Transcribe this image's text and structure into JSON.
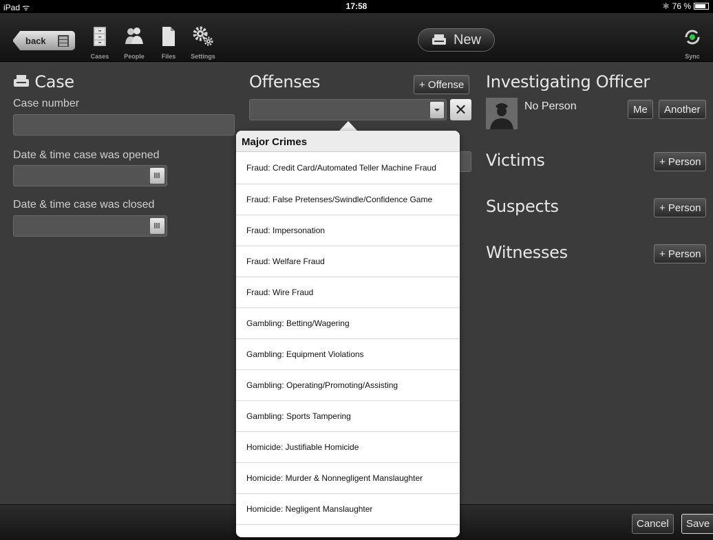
{
  "status_bar": {
    "device": "iPad",
    "time": "17:58",
    "battery": "76 %",
    "battery_level": 0.76
  },
  "toolbar": {
    "back_label": "back",
    "items": [
      {
        "label": "Cases",
        "icon": "cabinet-icon"
      },
      {
        "label": "People",
        "icon": "people-icon"
      },
      {
        "label": "Files",
        "icon": "files-icon"
      },
      {
        "label": "Settings",
        "icon": "gear-icon"
      }
    ],
    "new_label": "New",
    "sync_label": "Sync"
  },
  "case": {
    "title": "Case",
    "case_number_label": "Case number",
    "case_number_value": "",
    "opened_label": "Date & time case was opened",
    "opened_value": "",
    "closed_label": "Date & time case was closed",
    "closed_value": ""
  },
  "offenses": {
    "title": "Offenses",
    "add_label": "+ Offense",
    "selected_value": "",
    "clear_label": "✕"
  },
  "officer": {
    "title": "Investigating Officer",
    "person_name": "No Person",
    "me_label": "Me",
    "another_label": "Another"
  },
  "victims": {
    "title": "Victims",
    "add_label": "+ Person"
  },
  "suspects": {
    "title": "Suspects",
    "add_label": "+ Person"
  },
  "witnesses": {
    "title": "Witnesses",
    "add_label": "+ Person"
  },
  "footer": {
    "cancel_label": "Cancel",
    "save_label": "Save"
  },
  "popover": {
    "section_title": "Major Crimes",
    "items": [
      "Fraud: Credit Card/Automated Teller Machine Fraud",
      "Fraud: False Pretenses/Swindle/Confidence Game",
      "Fraud: Impersonation",
      "Fraud: Welfare Fraud",
      "Fraud: Wire Fraud",
      "Gambling: Betting/Wagering",
      "Gambling: Equipment Violations",
      "Gambling: Operating/Promoting/Assisting",
      "Gambling: Sports Tampering",
      "Homicide: Justifiable Homicide",
      "Homicide: Murder & Nonnegligent Manslaughter",
      "Homicide: Negligent Manslaughter"
    ]
  }
}
